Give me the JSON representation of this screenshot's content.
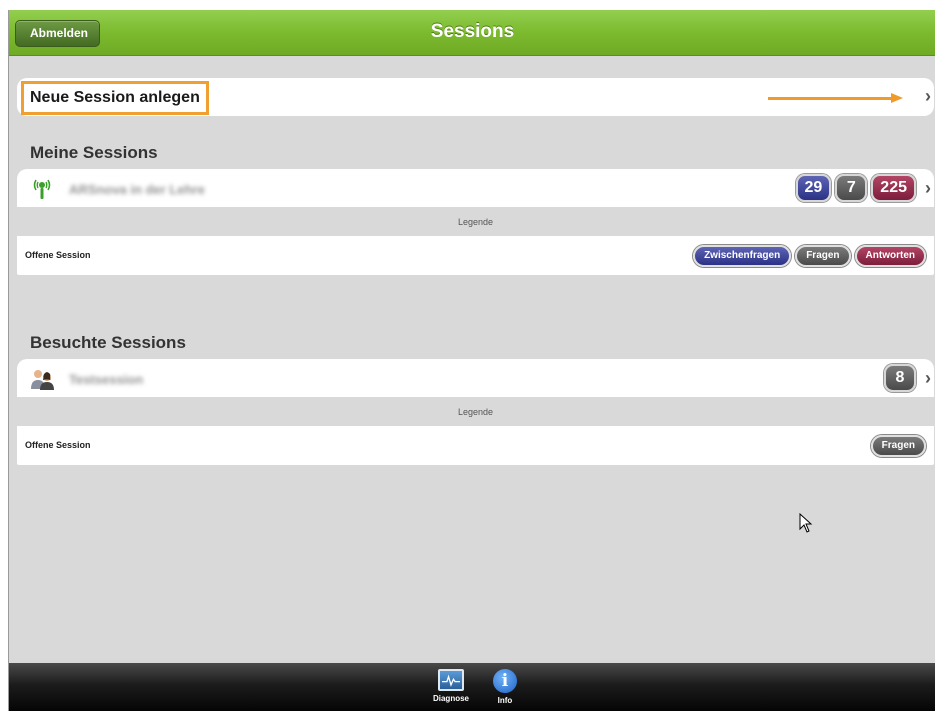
{
  "header": {
    "title": "Sessions",
    "back_label": "Abmelden"
  },
  "new_session": {
    "label": "Neue Session anlegen"
  },
  "my_sessions": {
    "title": "Meine Sessions",
    "session_name": "ARSnova in der Lehre",
    "badges": [
      "29",
      "7",
      "225"
    ],
    "legend_caption": "Legende",
    "legend_label": "Offene Session",
    "legend_pills": [
      "Zwischenfragen",
      "Fragen",
      "Antworten"
    ]
  },
  "visited_sessions": {
    "title": "Besuchte Sessions",
    "session_name": "Testsession",
    "badges": [
      "8"
    ],
    "legend_caption": "Legende",
    "legend_label": "Offene Session",
    "legend_pills": [
      "Fragen"
    ]
  },
  "footer": {
    "tabs": [
      "Diagnose",
      "Info"
    ]
  },
  "colors": {
    "header_green": "#7cba2f",
    "badge_blue": "#2b3286",
    "badge_gray": "#4a4a4a",
    "badge_red": "#7d1d3c",
    "highlight_orange": "#f0a030"
  }
}
